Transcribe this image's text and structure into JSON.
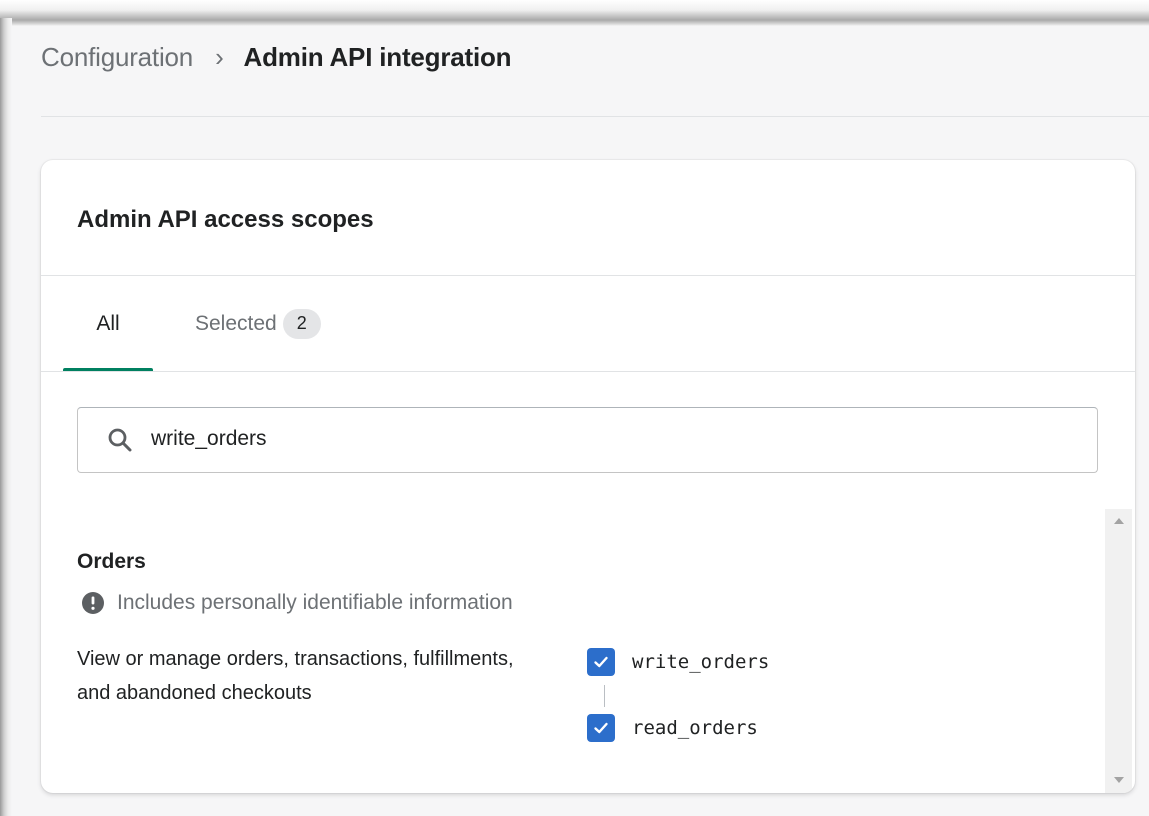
{
  "breadcrumb": {
    "parent": "Configuration",
    "separator": "›",
    "current": "Admin API integration"
  },
  "card": {
    "title": "Admin API access scopes",
    "tabs": [
      {
        "label": "All",
        "active": true
      },
      {
        "label": "Selected",
        "active": false,
        "badge": "2"
      }
    ],
    "search": {
      "value": "write_orders",
      "icon": "search-icon"
    },
    "sections": [
      {
        "title": "Orders",
        "notice": "Includes personally identifiable information",
        "notice_icon": "alert-circle-icon",
        "description": "View or manage orders, transactions, fulfillments, and abandoned checkouts",
        "scopes": [
          {
            "label": "write_orders",
            "checked": true
          },
          {
            "label": "read_orders",
            "checked": true
          }
        ]
      }
    ]
  },
  "colors": {
    "accent_tab": "#008060",
    "checkbox": "#2c6ecb",
    "badge_bg": "#e4e5e7",
    "muted_text": "#6d7175"
  }
}
